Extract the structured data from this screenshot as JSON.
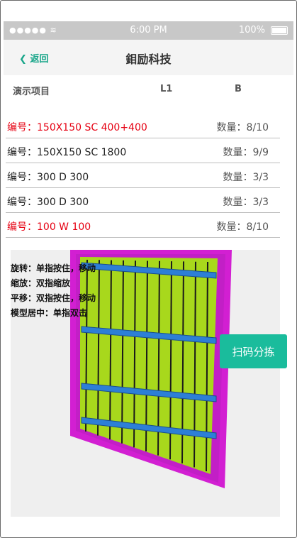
{
  "statusbar": {
    "signal": "●●●●● ≋",
    "time": "6:00 PM",
    "battery": "100%"
  },
  "navbar": {
    "back_label": "返回",
    "title": "鉬励科技"
  },
  "header": {
    "project": "演示项目",
    "l1": "L1",
    "b": "B"
  },
  "items": [
    {
      "code": "编号：150X150 SC 400+400",
      "qty": "数量：8/10",
      "highlight": true
    },
    {
      "code": "编号：150X150 SC 1800",
      "qty": "数量：9/9",
      "highlight": false
    },
    {
      "code": "编号：300 D 300",
      "qty": "数量：3/3",
      "highlight": false
    },
    {
      "code": "编号：300 D 300",
      "qty": "数量：3/3",
      "highlight": false
    },
    {
      "code": "编号：100 W 100",
      "qty": "数量：8/10",
      "highlight": true
    }
  ],
  "viewer": {
    "hints": [
      "旋转：单指按住，移动",
      "缩放：双指缩放",
      "平移：双指按住，移动",
      "模型居中：单指双击"
    ]
  },
  "scan_button": "扫码分拣",
  "colors": {
    "accent": "#1abc9c",
    "highlight_text": "#e60012",
    "panel": "#a8d81c",
    "frame": "#d21fd2",
    "rail": "#2d7fd6"
  }
}
